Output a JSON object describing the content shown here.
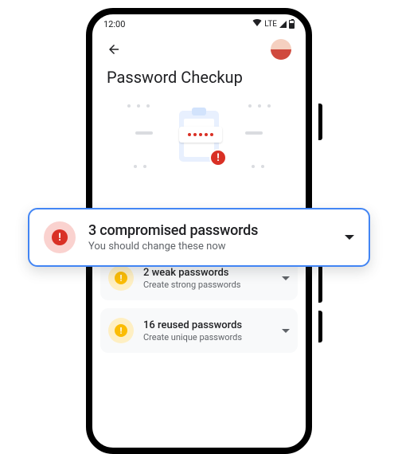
{
  "status_bar": {
    "time": "12:00",
    "network_label": "LTE"
  },
  "header": {
    "title": "Password Checkup"
  },
  "callout": {
    "title": "3 compromised passwords",
    "subtitle": "You should change these now"
  },
  "items": [
    {
      "title": "2 weak passwords",
      "subtitle": "Create strong passwords"
    },
    {
      "title": "16 reused passwords",
      "subtitle": "Create unique passwords"
    }
  ]
}
